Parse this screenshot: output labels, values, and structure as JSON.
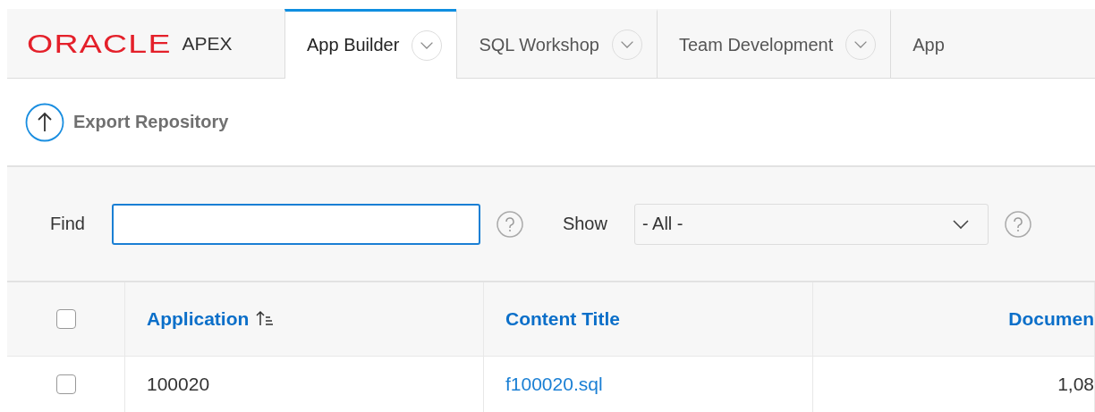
{
  "logo": {
    "brand": "ORACLE",
    "product": "APEX"
  },
  "tabs": [
    {
      "label": "App Builder",
      "selected": true,
      "menu": true
    },
    {
      "label": "SQL Workshop",
      "selected": false,
      "menu": true
    },
    {
      "label": "Team Development",
      "selected": false,
      "menu": true
    },
    {
      "label": "App",
      "selected": false,
      "menu": false
    }
  ],
  "toolbar": {
    "button": "Export Repository"
  },
  "filters": {
    "find_label": "Find",
    "show_label": "Show",
    "show_value": "- All -"
  },
  "table": {
    "select_all_checked": false,
    "columns": [
      {
        "label": "Application",
        "sorted": true,
        "kind": "text"
      },
      {
        "label": "Content Title",
        "sorted": false,
        "kind": "text"
      },
      {
        "label": "Documen",
        "sorted": false,
        "kind": "number"
      }
    ],
    "rows": [
      {
        "checked": false,
        "cells": [
          {
            "text": "100020",
            "link": false
          },
          {
            "text": "f100020.sql",
            "link": true
          },
          {
            "text": "1,08",
            "link": false
          }
        ]
      }
    ]
  }
}
